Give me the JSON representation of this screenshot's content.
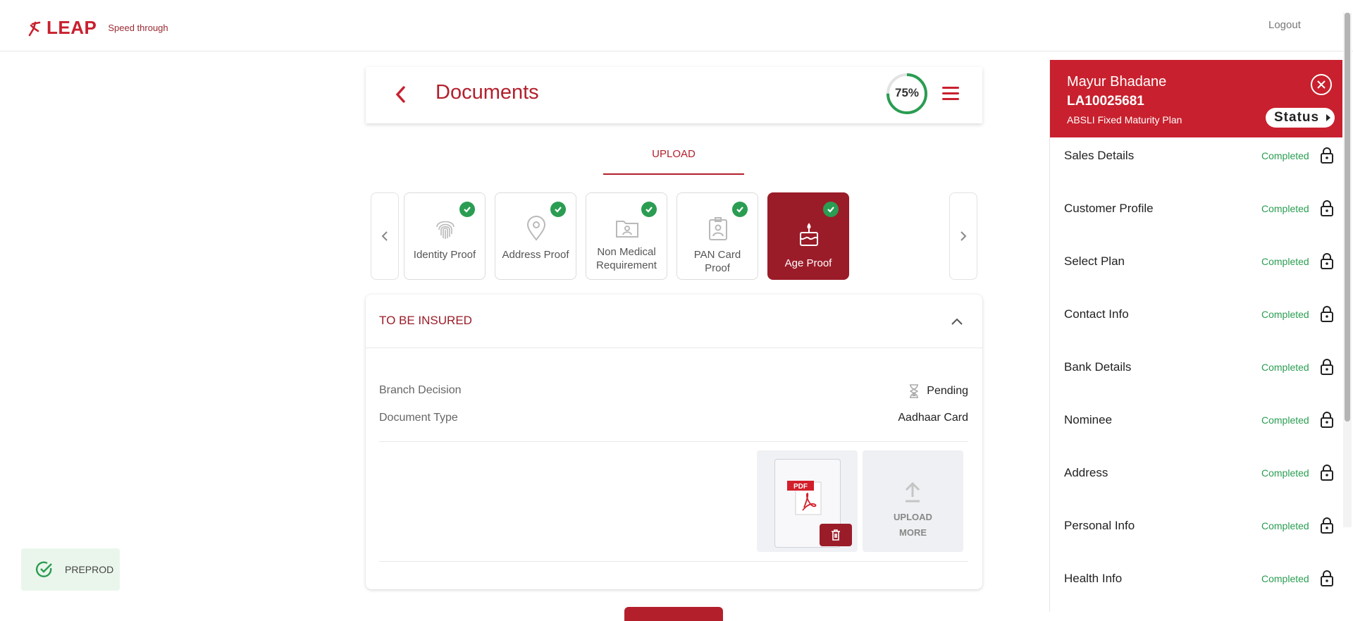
{
  "header": {
    "brand": "LEAP",
    "tagline": "Speed through",
    "logout": "Logout"
  },
  "page": {
    "title": "Documents",
    "progress_text": "75%",
    "progress_value": 0.75,
    "tab": "UPLOAD"
  },
  "doc_tabs": [
    {
      "label": "Identity Proof",
      "icon": "fingerprint-icon",
      "completed": true
    },
    {
      "label": "Address Proof",
      "icon": "location-pin-icon",
      "completed": true
    },
    {
      "label": "Non Medical Requirement",
      "icon": "folder-person-icon",
      "completed": true
    },
    {
      "label": "PAN Card Proof",
      "icon": "id-badge-icon",
      "completed": true
    },
    {
      "label": "Age Proof",
      "icon": "birthday-cake-icon",
      "completed": true,
      "active": true
    }
  ],
  "insured": {
    "title": "TO BE INSURED",
    "branch_decision_label": "Branch Decision",
    "branch_decision_value": "Pending",
    "doc_type_label": "Document Type",
    "doc_type_value": "Aadhaar Card",
    "file_badge": "PDF",
    "upload_more": "UPLOAD MORE"
  },
  "preprod": "PREPROD",
  "panel": {
    "name": "Mayur Bhadane",
    "id": "LA10025681",
    "plan": "ABSLI Fixed Maturity Plan",
    "status": "Status",
    "steps": [
      {
        "name": "Sales Details",
        "status": "Completed"
      },
      {
        "name": "Customer Profile",
        "status": "Completed"
      },
      {
        "name": "Select Plan",
        "status": "Completed"
      },
      {
        "name": "Contact Info",
        "status": "Completed"
      },
      {
        "name": "Bank Details",
        "status": "Completed"
      },
      {
        "name": "Nominee",
        "status": "Completed"
      },
      {
        "name": "Address",
        "status": "Completed"
      },
      {
        "name": "Personal Info",
        "status": "Completed"
      },
      {
        "name": "Health Info",
        "status": "Completed"
      }
    ]
  },
  "colors": {
    "brand": "#c8202e",
    "active_card": "#9b1c29",
    "success": "#2a9d52"
  }
}
